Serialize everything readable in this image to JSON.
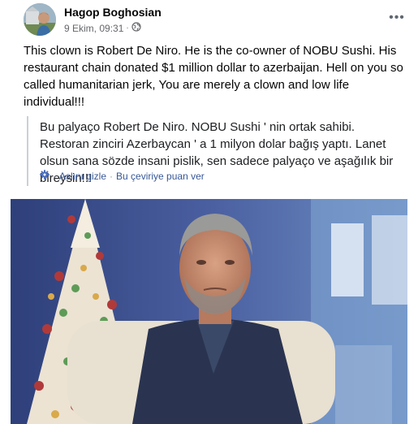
{
  "post": {
    "author": "Hagop Boghosian",
    "date": "9 Ekim, 09:31",
    "separator": "·",
    "audience_icon": "globe-icon",
    "more_icon": "more-options-icon",
    "text": "This clown is Robert De Niro. He is the co-owner of NOBU Sushi. His restaurant chain donated $1 million dollar to azerbaijan. Hell on you so called humanitarian jerk, You are merely a clown and low life individual!!!"
  },
  "translation": {
    "text": "Bu palyaço Robert De Niro. NOBU Sushi ' nin ortak sahibi. Restoran zinciri Azerbaycan ' a 1 milyon dolar bağış yaptı. Lanet olsun sana sözde insani pislik, sen sadece palyaço ve aşağılık bir bireysin!!!",
    "hide_original": "Aslını gizle",
    "rate_translation": "Bu çeviriye puan ver",
    "separator": "·",
    "settings_icon": "gear-icon"
  },
  "colors": {
    "link": "#385898",
    "meta": "#65676b",
    "quote_border": "#ccd0d5"
  }
}
